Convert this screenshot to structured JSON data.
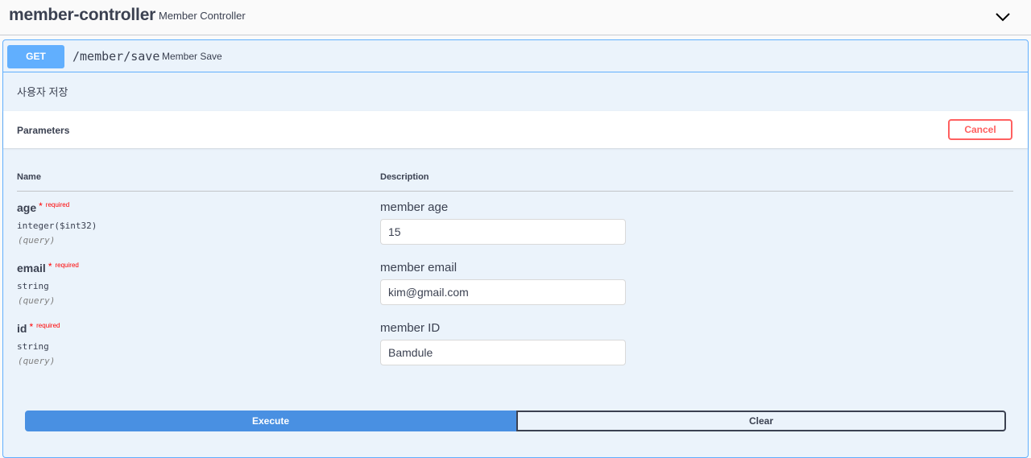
{
  "tag": {
    "name": "member-controller",
    "description": "Member Controller",
    "toggle_icon": "chevron-down-icon"
  },
  "operation": {
    "method": "GET",
    "path": "/member/save",
    "summary": "Member Save",
    "description": "사용자 저장",
    "colors": {
      "accent": "#61affe",
      "background": "#ebf3fb",
      "execute": "#4990e2",
      "cancel": "#ff6060"
    }
  },
  "parameters": {
    "title": "Parameters",
    "cancel_label": "Cancel",
    "columns": {
      "name": "Name",
      "description": "Description"
    },
    "items": [
      {
        "name": "age",
        "star": "*",
        "required": "required",
        "type": "integer($int32)",
        "in": "(query)",
        "description": "member age",
        "value": "15"
      },
      {
        "name": "email",
        "star": "*",
        "required": "required",
        "type": "string",
        "in": "(query)",
        "description": "member email",
        "value": "kim@gmail.com"
      },
      {
        "name": "id",
        "star": "*",
        "required": "required",
        "type": "string",
        "in": "(query)",
        "description": "member ID",
        "value": "Bamdule"
      }
    ]
  },
  "actions": {
    "execute_label": "Execute",
    "clear_label": "Clear"
  }
}
